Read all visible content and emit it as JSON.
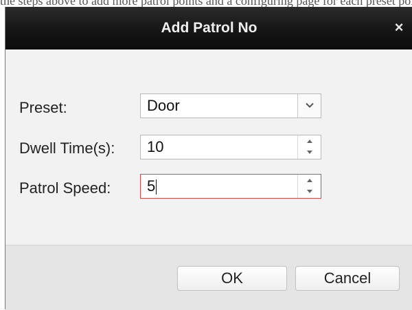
{
  "background": {
    "text": "the steps above to add more patrol points and a configuring page for each preset point."
  },
  "dialog": {
    "title": "Add Patrol No",
    "close_glyph": "×"
  },
  "form": {
    "preset": {
      "label": "Preset:",
      "value": "Door"
    },
    "dwell_time": {
      "label": "Dwell Time(s):",
      "value": "10"
    },
    "patrol_speed": {
      "label": "Patrol Speed:",
      "value": "5"
    }
  },
  "buttons": {
    "ok": "OK",
    "cancel": "Cancel"
  },
  "icons": {
    "close": "close-icon",
    "dropdown": "chevron-down-icon",
    "spin_up": "triangle-up-icon",
    "spin_down": "triangle-down-icon"
  },
  "colors": {
    "titlebar": "#141414",
    "dialog_bg": "#f2f2f2",
    "footer_bg": "#e4e4e4",
    "focus_border": "#d24a4a"
  }
}
